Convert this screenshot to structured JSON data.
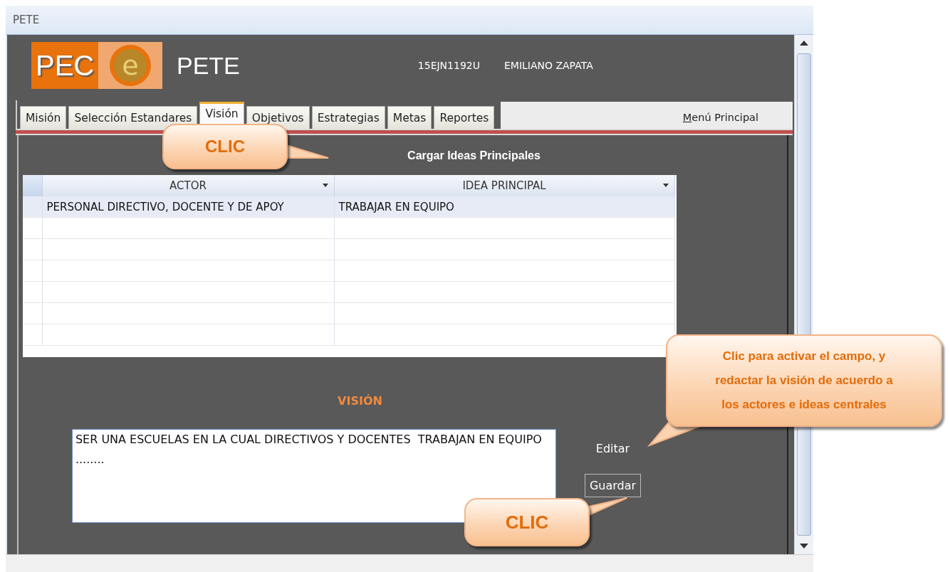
{
  "window": {
    "title": "PETE"
  },
  "header": {
    "logo_text": "PEC",
    "logo_mark": "e",
    "app_title": "PETE",
    "school_code": "15EJN1192U",
    "school_name": "EMILIANO ZAPATA"
  },
  "tabs": [
    {
      "label": "Misión",
      "selected": false
    },
    {
      "label": "Selección Estandares",
      "selected": false
    },
    {
      "label": "Visión",
      "selected": true
    },
    {
      "label": "Objetivos",
      "selected": false
    },
    {
      "label": "Estrategias",
      "selected": false
    },
    {
      "label": "Metas",
      "selected": false
    },
    {
      "label": "Reportes",
      "selected": false
    }
  ],
  "menu_button": "Menú Principal",
  "load_button": "Cargar Ideas Principales",
  "table": {
    "columns": [
      "ACTOR",
      "IDEA PRINCIPAL"
    ],
    "rows": [
      {
        "cells": [
          "PERSONAL DIRECTIVO, DOCENTE Y DE APOY",
          "TRABAJAR EN EQUIPO"
        ],
        "selected": true
      }
    ]
  },
  "vision": {
    "heading": "VISIÓN",
    "value": "SER UNA ESCUELAS EN LA CUAL DIRECTIVOS Y DOCENTES  TRABAJAN EN EQUIPO ........",
    "edit_button": "Editar",
    "save_button": "Guardar"
  },
  "callouts": [
    {
      "text": "CLIC"
    },
    {
      "text": "Clic para activar el campo, y redactar la visión de acuerdo a los actores e ideas centrales"
    },
    {
      "text": "CLIC"
    }
  ]
}
